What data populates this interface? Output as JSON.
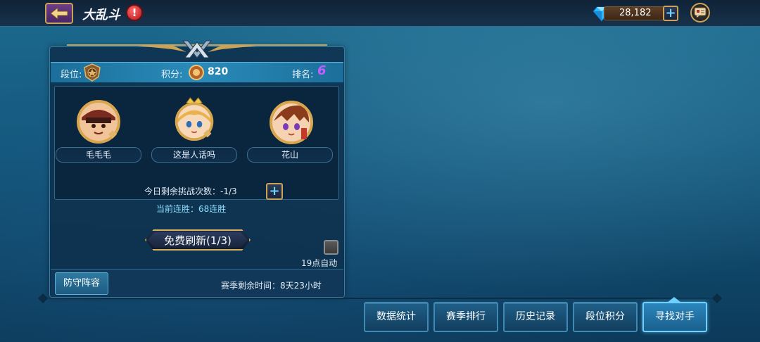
{
  "header": {
    "title": "大乱斗",
    "info_icon_glyph": "!",
    "currency_amount": "28,182",
    "currency_plus": "+"
  },
  "stats": {
    "rank_label": "段位:",
    "points_label": "积分:",
    "points_value": "820",
    "place_label": "排名:",
    "place_value": "6"
  },
  "opponents": [
    {
      "name": "毛毛毛"
    },
    {
      "name": "这是人话吗"
    },
    {
      "name": "花山"
    }
  ],
  "challenge": {
    "remaining_text": "今日剩余挑战次数：-1/3",
    "plus": "+"
  },
  "streak_text": "当前连胜：68连胜",
  "refresh_button": "免费刷新(1/3)",
  "auto_label": "19点自动",
  "defense_button": "防守阵容",
  "season_text": "赛季剩余时间：8天23小时",
  "bottom_tabs": [
    {
      "label": "数据统计"
    },
    {
      "label": "赛季排行"
    },
    {
      "label": "历史记录"
    },
    {
      "label": "段位积分"
    },
    {
      "label": "寻找对手"
    }
  ],
  "colors": {
    "accent_gold": "#c9a35a",
    "place_purple": "#c45cff",
    "streak_cyan": "#8fe0ff"
  },
  "icons": {
    "back": "back-arrow-icon",
    "info": "exclamation-icon",
    "gem": "diamond-gem-icon",
    "chat": "chat-icon",
    "rank": "rank-badge-icon",
    "points": "points-coin-icon"
  }
}
